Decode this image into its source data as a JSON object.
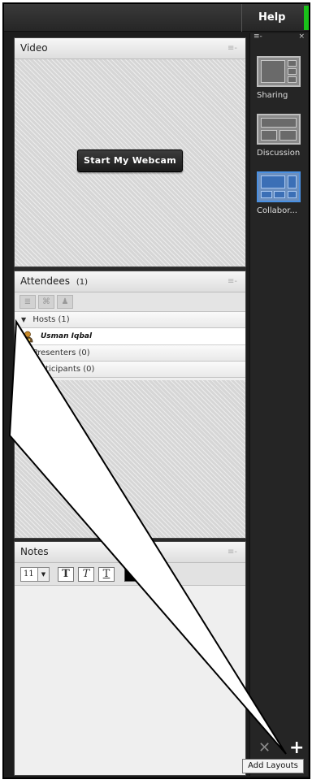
{
  "menu": {
    "help_label": "Help"
  },
  "video_pod": {
    "title": "Video",
    "menu_icon": "≡-",
    "webcam_button": "Start My Webcam"
  },
  "attendees_pod": {
    "title": "Attendees",
    "count": "(1)",
    "menu_icon": "≡-",
    "groups": {
      "hosts": "Hosts (1)",
      "presenters": "Presenters (0)",
      "participants": "Participants (0)"
    },
    "host_user": "Usman Iqbal"
  },
  "notes_pod": {
    "title": "Notes",
    "menu_icon": "≡-",
    "font_size": "11",
    "bold_label": "T",
    "italic_label": "T",
    "underline_label": "T"
  },
  "layouts_panel": {
    "menu_icon": "≡-",
    "close_icon": "×",
    "items": [
      {
        "label": "Sharing"
      },
      {
        "label": "Discussion"
      },
      {
        "label": "Collabor..."
      }
    ],
    "delete_icon": "✕",
    "add_icon": "+",
    "tooltip": "Add Layouts"
  },
  "colors": {
    "accent_green": "#19c119",
    "active_layout_border": "#4a90e2"
  }
}
